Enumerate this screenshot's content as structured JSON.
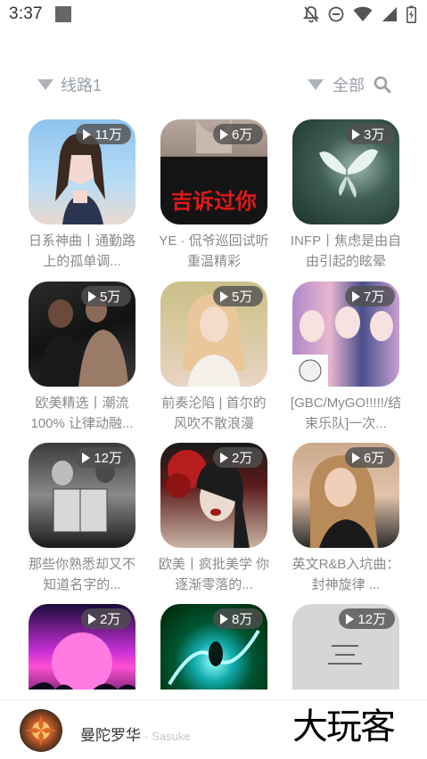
{
  "status_bar": {
    "time": "3:37",
    "icons": [
      "notifications-off-icon",
      "do-not-disturb-icon",
      "wifi-icon",
      "cellular-signal-icon",
      "battery-charging-icon"
    ]
  },
  "filters": {
    "route_label": "线路1",
    "category_label": "全部"
  },
  "playlists": [
    {
      "plays": "11万",
      "title": "日系神曲丨通勤路上的孤单调..."
    },
    {
      "plays": "6万",
      "title": "YE · 侃爷巡回试听 重温精彩"
    },
    {
      "plays": "3万",
      "title": "INFP丨焦虑是由自由引起的眩晕"
    },
    {
      "plays": "5万",
      "title": "欧美精选丨潮流100% 让律动融..."
    },
    {
      "plays": "5万",
      "title": "前奏沦陷 | 首尔的风吹不散浪漫"
    },
    {
      "plays": "7万",
      "title": "[GBC/MyGO!!!!!/结束乐队]一次..."
    },
    {
      "plays": "12万",
      "title": "那些你熟悉却又不知道名字的..."
    },
    {
      "plays": "2万",
      "title": "欧美丨疯批美学 你逐渐零落的..."
    },
    {
      "plays": "6万",
      "title": "英文R&B入坑曲：封神旋律 ..."
    },
    {
      "plays": "2万",
      "title": ""
    },
    {
      "plays": "8万",
      "title": ""
    },
    {
      "plays": "12万",
      "title": ""
    }
  ],
  "thumb_text": {
    "card2": "吉诉过你"
  },
  "player": {
    "song": "曼陀罗华",
    "separator": "-",
    "artist": "Sasuke"
  },
  "watermark": "大玩客"
}
